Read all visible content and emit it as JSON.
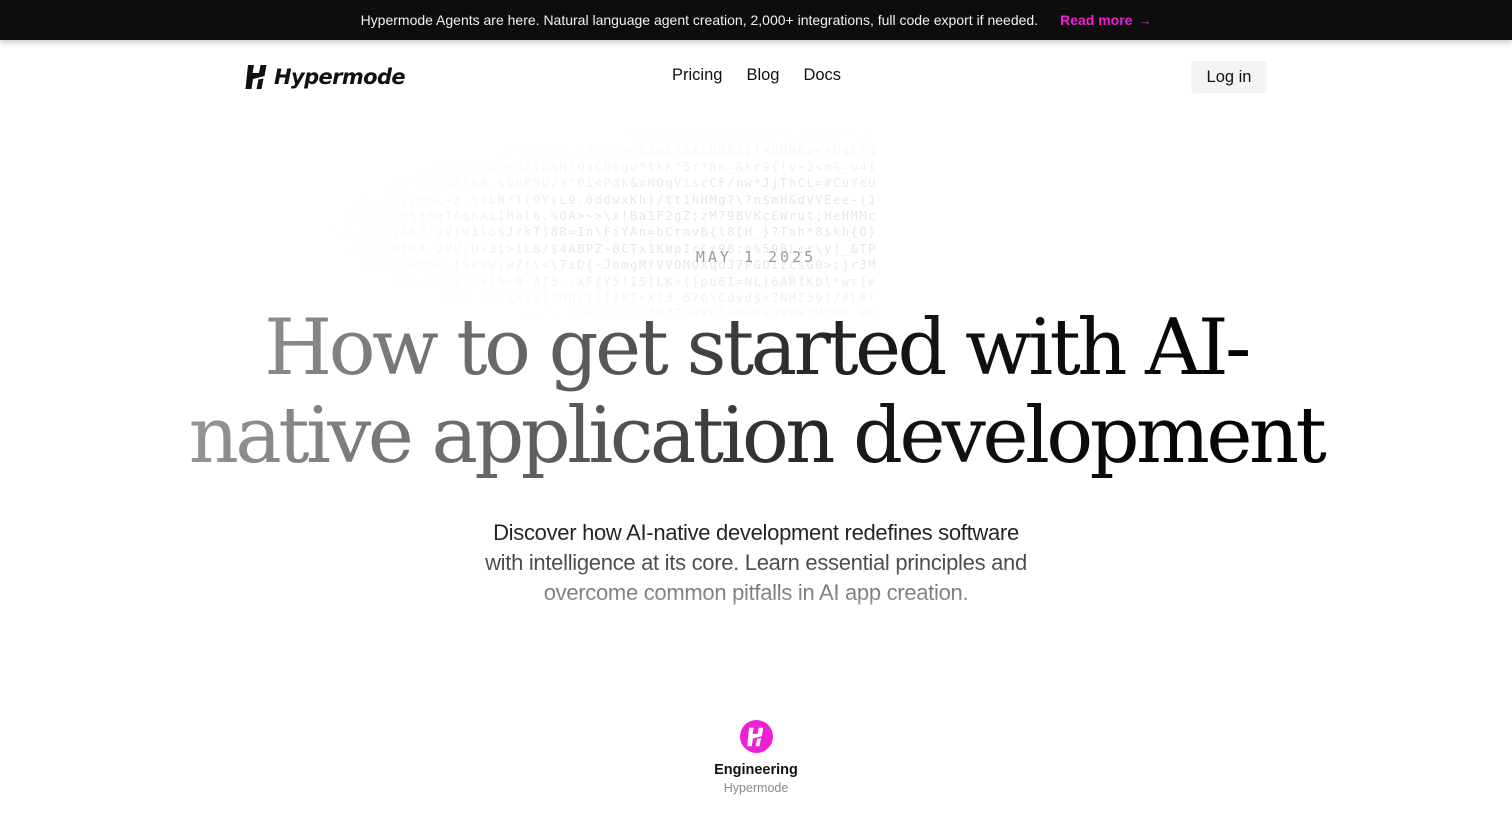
{
  "announcement": {
    "text": "Hypermode Agents are here. Natural language agent creation, 2,000+ integrations, full code export if needed.",
    "link_label": "Read more",
    "link_icon": "arrow-right-icon",
    "accent_color": "#ee20d6"
  },
  "header": {
    "logo_text": "Hypermode",
    "logo_icon": "hypermode-logo-icon",
    "nav": [
      {
        "label": "Pricing"
      },
      {
        "label": "Blog"
      },
      {
        "label": "Docs"
      }
    ],
    "login_label": "Log in"
  },
  "hero": {
    "date": "MAY 1 2025",
    "title": "How to get started with AI-native application development",
    "subtitle": "Discover how AI-native development redefines software with intelligence at its core. Learn essential principles and overcome common pitfalls in AI app creation."
  },
  "author": {
    "name": "Engineering",
    "org": "Hypermode",
    "avatar_icon": "hypermode-avatar-icon",
    "avatar_color": "#ee20d6"
  }
}
